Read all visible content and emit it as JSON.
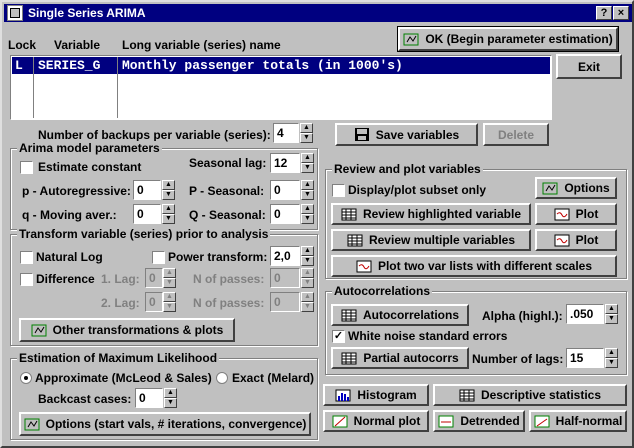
{
  "window": {
    "title": "Single Series ARIMA",
    "help_btn": "?",
    "close_btn": "×"
  },
  "colors": {
    "titlebar": "#000080",
    "face": "#c0c0c0",
    "selection": "#000080"
  },
  "top": {
    "ok_label": "OK (Begin parameter estimation)",
    "exit_label": "Exit",
    "col_lock": "Lock",
    "col_variable": "Variable",
    "col_long_name": "Long variable (series) name",
    "rows": [
      {
        "lock": "L",
        "variable": "SERIES_G",
        "long_name": "Monthly passenger totals (in 1000's)"
      }
    ]
  },
  "backups": {
    "label": "Number of backups per variable (series):",
    "value": "4"
  },
  "save_variables_label": "Save variables",
  "delete_label": "Delete",
  "arima": {
    "title": "Arima model parameters",
    "estimate_constant": "Estimate constant",
    "seasonal_lag_label": "Seasonal lag:",
    "seasonal_lag": "12",
    "p_label": "p - Autoregressive:",
    "p_value": "0",
    "P_label": "P - Seasonal:",
    "P_value": "0",
    "q_label": "q - Moving aver.:",
    "q_value": "0",
    "Q_label": "Q - Seasonal:",
    "Q_value": "0"
  },
  "transform": {
    "title": "Transform variable (series) prior to analysis",
    "natural_log": "Natural Log",
    "power_transform": "Power transform:",
    "power_value": "2,0",
    "difference": "Difference",
    "lag1_label": "1. Lag:",
    "lag1_value": "0",
    "passes1_label": "N of passes:",
    "passes1_value": "0",
    "lag2_label": "2. Lag:",
    "lag2_value": "0",
    "passes2_label": "N of passes:",
    "passes2_value": "0",
    "other_label": "Other transformations & plots"
  },
  "estimation": {
    "title": "Estimation of Maximum Likelihood",
    "approximate": "Approximate (McLeod & Sales)",
    "exact": "Exact (Melard)",
    "backcast_label": "Backcast cases:",
    "backcast_value": "0",
    "options_label": "Options (start vals, # iterations, convergence)"
  },
  "review": {
    "title": "Review and plot variables",
    "display_subset": "Display/plot subset only",
    "options_label": "Options",
    "review_highlighted": "Review highlighted variable",
    "plot1": "Plot",
    "review_multiple": "Review multiple variables",
    "plot2": "Plot",
    "plot_two_lists": "Plot two var lists with different scales"
  },
  "autocorr": {
    "title": "Autocorrelations",
    "autocorr_btn": "Autocorrelations",
    "alpha_label": "Alpha (highl.):",
    "alpha_value": ".050",
    "white_noise": "White noise standard errors",
    "partial_btn": "Partial autocorrs",
    "nlags_label": "Number of lags:",
    "nlags_value": "15"
  },
  "bottom": {
    "histogram": "Histogram",
    "descriptive": "Descriptive statistics",
    "normal_plot": "Normal plot",
    "detrended": "Detrended",
    "half_normal": "Half-normal"
  }
}
